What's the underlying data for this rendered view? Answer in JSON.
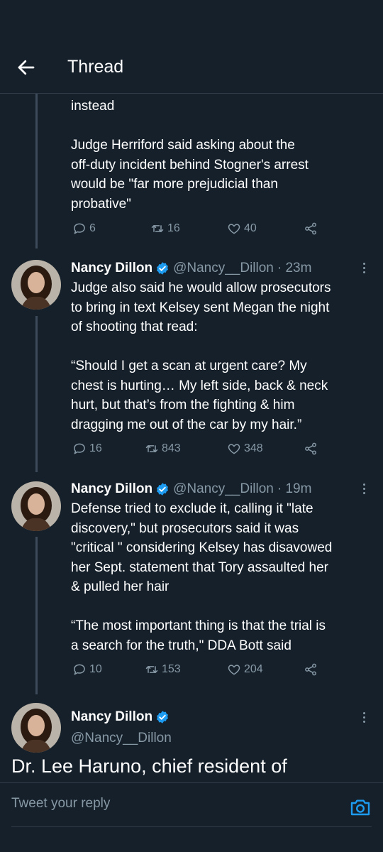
{
  "header": {
    "title": "Thread"
  },
  "tweets": [
    {
      "text": "instead\n\nJudge Herriford said asking about the\noff-duty incident behind Stogner's arrest\nwould be \"far more prejudicial than\nprobative\"",
      "replies": "6",
      "retweets": "16",
      "likes": "40"
    },
    {
      "name": "Nancy Dillon",
      "handle": "@Nancy__Dillon",
      "time": "· 23m",
      "text": "Judge also said he would allow prosecutors\nto bring in text Kelsey sent Megan the night\nof shooting that read:\n\n“Should I get a scan at urgent care? My\nchest is hurting… My left side, back & neck\nhurt, but that’s from the fighting & him\ndragging me out of the car by my hair.”",
      "replies": "16",
      "retweets": "843",
      "likes": "348"
    },
    {
      "name": "Nancy Dillon",
      "handle": "@Nancy__Dillon",
      "time": "· 19m",
      "text": "Defense tried to exclude it, calling it \"late\ndiscovery,\" but prosecutors said it was\n\"critical \" considering Kelsey has disavowed\nher Sept. statement that Tory assaulted her\n& pulled her hair\n\n“The most important thing is that the trial is\na search for the truth,\" DDA Bott said",
      "replies": "10",
      "retweets": "153",
      "likes": "204"
    },
    {
      "name": "Nancy Dillon",
      "handle": "@Nancy__Dillon",
      "text": "Dr. Lee Haruno, chief resident of"
    }
  ],
  "reply": {
    "placeholder": "Tweet your reply"
  },
  "icons": {
    "back": "arrow-left-icon",
    "reply": "speech-bubble-icon",
    "retweet": "retweet-icon",
    "like": "heart-icon",
    "share": "share-icon",
    "verified": "verified-badge-icon",
    "more": "vertical-dots-icon",
    "camera": "camera-icon"
  },
  "colors": {
    "background": "#15202b",
    "muted": "#8899a6",
    "accent": "#1d9bf0",
    "divider": "#2f3b48"
  }
}
